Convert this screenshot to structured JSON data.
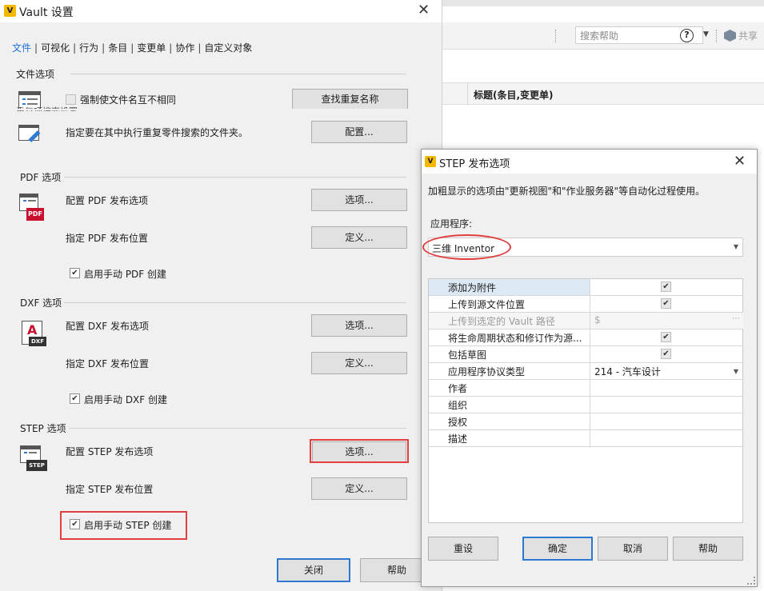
{
  "background": {
    "search_placeholder": "搜索帮助",
    "share_label": "共享",
    "column_header": "标题(条目,变更单)"
  },
  "vault": {
    "title": "Vault 设置",
    "logo": "V",
    "tabs": [
      "文件",
      "可视化",
      "行为",
      "条目",
      "变更单",
      "协作",
      "自定义对象"
    ],
    "file_section": {
      "title": "文件选项",
      "force_unique_label": "强制使文件名互不相同",
      "find_duplicates_button": "查找重复名称",
      "dup_search_overlay": "重复项搜索设置",
      "dup_folder_desc": "指定要在其中执行重复零件搜索的文件夹。",
      "config_button": "配置..."
    },
    "pdf": {
      "title": "PDF 选项",
      "icon_text": "PDF",
      "config_label": "配置 PDF 发布选项",
      "options_button": "选项...",
      "location_label": "指定 PDF 发布位置",
      "define_button": "定义...",
      "manual_label": "启用手动 PDF 创建"
    },
    "dxf": {
      "title": "DXF 选项",
      "icon_text": "DXF",
      "config_label": "配置 DXF 发布选项",
      "options_button": "选项...",
      "location_label": "指定 DXF 发布位置",
      "define_button": "定义...",
      "manual_label": "启用手动 DXF 创建"
    },
    "step": {
      "title": "STEP 选项",
      "icon_text": "STEP",
      "config_label": "配置 STEP 发布选项",
      "options_button": "选项...",
      "location_label": "指定 STEP 发布位置",
      "define_button": "定义...",
      "manual_label": "启用手动 STEP 创建"
    },
    "close_button": "关闭",
    "help_button": "帮助",
    "check": "✔"
  },
  "step_dialog": {
    "title": "STEP 发布选项",
    "info": "加粗显示的选项由\"更新视图\"和\"作业服务器\"等自动化过程使用。",
    "app_label": "应用程序:",
    "app_value": "三维 Inventor",
    "rows": [
      {
        "name": "添加为附件",
        "value": ""
      },
      {
        "name": "上传到源文件位置",
        "value": ""
      },
      {
        "name": "上传到选定的 Vault 路径",
        "value": "$"
      },
      {
        "name": "将生命周期状态和修订作为源...",
        "value": ""
      },
      {
        "name": "包括草图",
        "value": ""
      },
      {
        "name": "应用程序协议类型",
        "value": "214 - 汽车设计"
      },
      {
        "name": "作者",
        "value": ""
      },
      {
        "name": "组织",
        "value": ""
      },
      {
        "name": "授权",
        "value": ""
      },
      {
        "name": "描述",
        "value": ""
      }
    ],
    "reset_button": "重设",
    "ok_button": "确定",
    "cancel_button": "取消",
    "help_button": "帮助"
  }
}
